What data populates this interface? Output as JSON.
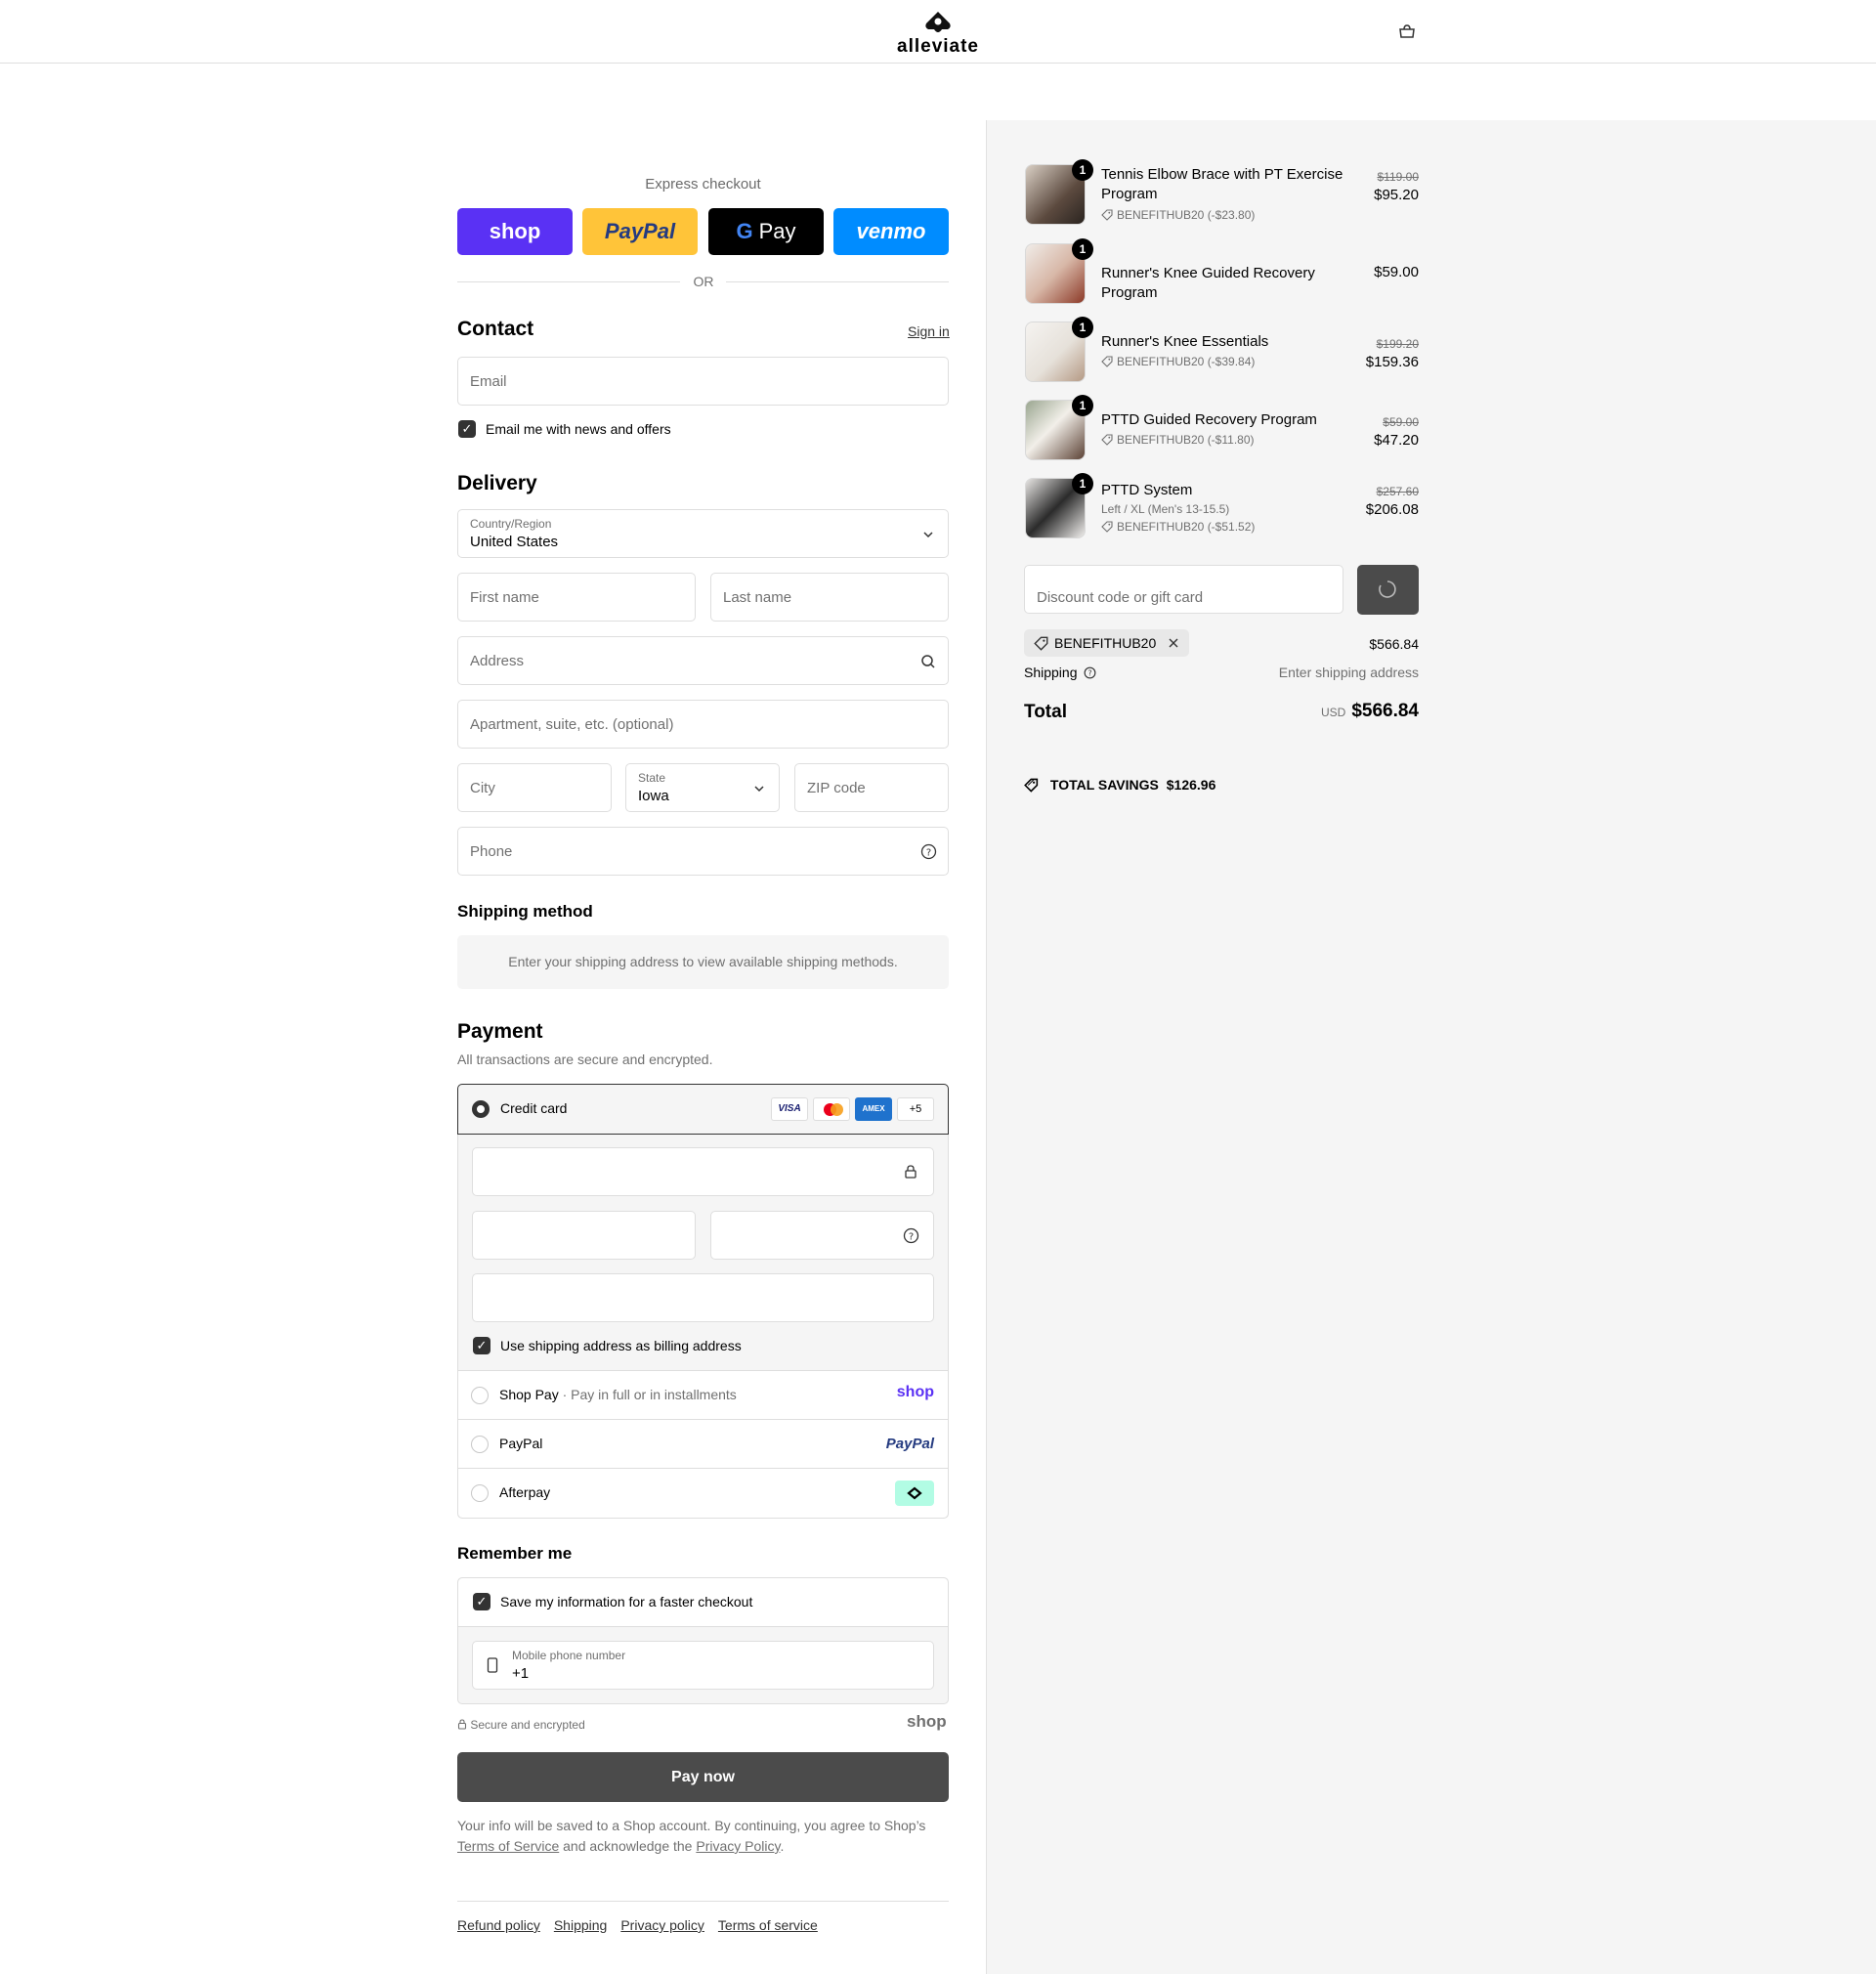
{
  "header": {
    "brand": "alleviate"
  },
  "express": {
    "label": "Express checkout",
    "buttons": [
      "shop",
      "PayPal",
      "Pay",
      "venmo"
    ],
    "or": "OR"
  },
  "contact": {
    "title": "Contact",
    "sign_in": "Sign in",
    "email_placeholder": "Email",
    "news_label": "Email me with news and offers"
  },
  "delivery": {
    "title": "Delivery",
    "country_label": "Country/Region",
    "country_value": "United States",
    "first_name": "First name",
    "last_name": "Last name",
    "address": "Address",
    "apartment": "Apartment, suite, etc. (optional)",
    "city": "City",
    "state_label": "State",
    "state_value": "Iowa",
    "zip": "ZIP code",
    "phone": "Phone"
  },
  "shipping_method": {
    "title": "Shipping method",
    "message": "Enter your shipping address to view available shipping methods."
  },
  "payment": {
    "title": "Payment",
    "subtitle": "All transactions are secure and encrypted.",
    "credit_card": "Credit card",
    "card_brands": [
      "VISA",
      "AMEX",
      "+5"
    ],
    "billing_label": "Use shipping address as billing address",
    "shop_pay": "Shop Pay",
    "shop_pay_note": "Pay in full or in installments",
    "shop_pay_logo": "shop",
    "paypal": "PayPal",
    "paypal_logo": "PayPal",
    "afterpay": "Afterpay"
  },
  "remember": {
    "title": "Remember me",
    "save_label": "Save my information for a faster checkout",
    "mobile_label": "Mobile phone number",
    "mobile_value": "+1",
    "secure": "Secure and encrypted",
    "shop_logo": "shop"
  },
  "pay_now": "Pay now",
  "legal": {
    "text1": "Your info will be saved to a Shop account. By continuing, you agree to Shop’s",
    "terms": "Terms of Service",
    "text2": "and acknowledge the",
    "privacy": "Privacy Policy",
    "end": "."
  },
  "footer_links": [
    "Refund policy",
    "Shipping",
    "Privacy policy",
    "Terms of service"
  ],
  "summary": {
    "items": [
      {
        "name_line1": "Tennis Elbow Brace with PT Exercise",
        "name_line2": "Program",
        "qty": "1",
        "discount": "BENEFITHUB20 (-$23.80)",
        "original": "$119.00",
        "price": "$95.20"
      },
      {
        "name_line1": "Runner's Knee Guided Recovery Program",
        "qty": "1",
        "price": "$59.00"
      },
      {
        "name_line1": "Runner's Knee Essentials",
        "qty": "1",
        "discount": "BENEFITHUB20 (-$39.84)",
        "original": "$199.20",
        "price": "$159.36"
      },
      {
        "name_line1": "PTTD Guided Recovery Program",
        "qty": "1",
        "discount": "BENEFITHUB20 (-$11.80)",
        "original": "$59.00",
        "price": "$47.20"
      },
      {
        "name_line1": "PTTD System",
        "variant": "Left / XL (Men's 13-15.5)",
        "qty": "1",
        "discount": "BENEFITHUB20 (-$51.52)",
        "original": "$257.60",
        "price": "$206.08"
      }
    ],
    "discount_placeholder": "Discount code or gift card",
    "applied_code": "BENEFITHUB20",
    "subtotal": "$566.84",
    "shipping_label": "Shipping",
    "shipping_value": "Enter shipping address",
    "total_label": "Total",
    "currency": "USD",
    "total": "$566.84",
    "savings_label": "TOTAL SAVINGS",
    "savings_value": "$126.96"
  }
}
